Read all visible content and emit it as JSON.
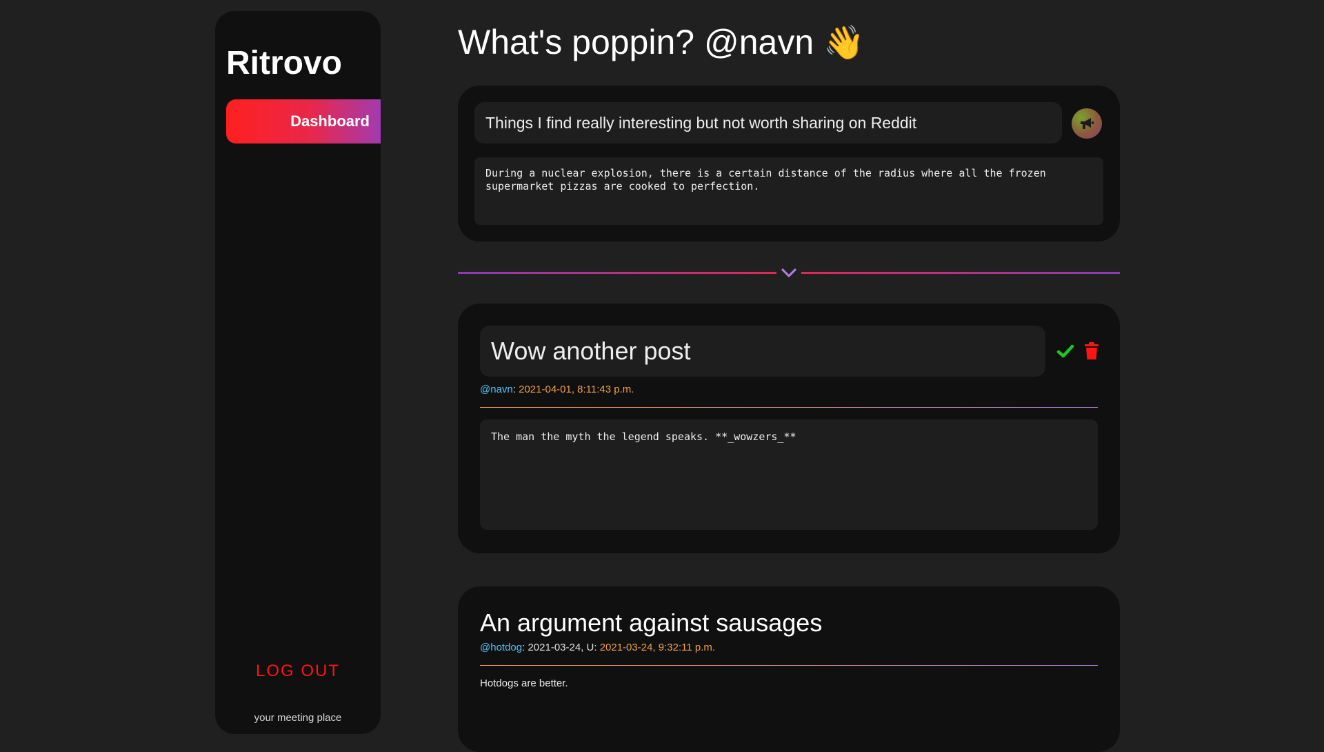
{
  "sidebar": {
    "brand": "Ritrovo",
    "nav": [
      {
        "label": "Dashboard",
        "active": true
      }
    ],
    "logout_label": "LOG OUT",
    "tagline": "your meeting place"
  },
  "header": {
    "greeting": "What's poppin? @navn",
    "wave_emoji": "👋"
  },
  "composer": {
    "title_value": "Things I find really interesting but not worth sharing on Reddit",
    "body_value": "During a nuclear explosion, there is a certain distance of the radius where all the frozen supermarket pizzas are cooked to perfection.",
    "publish_icon": "megaphone-icon"
  },
  "posts": [
    {
      "editing": true,
      "title": "Wow another post",
      "author": "@navn",
      "separator": ": ",
      "date": "2021-04-01, 8:11:43 p.m.",
      "body": "The man the myth the legend speaks. **_wowzers_**"
    },
    {
      "editing": false,
      "title": "An argument against sausages",
      "author": "@hotdog",
      "separator": ": ",
      "created": "2021-03-24, U: ",
      "updated": "2021-03-24, 9:32:11 p.m.",
      "body": "Hotdogs are better."
    }
  ],
  "colors": {
    "accent_red": "#ff1414",
    "handle": "#4fc3f7",
    "date": "#f0a04b",
    "confirm": "#1ec81e",
    "delete": "#ff1414"
  }
}
